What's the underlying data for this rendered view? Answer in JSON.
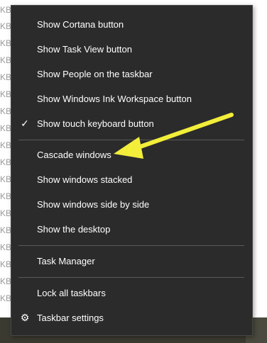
{
  "background": {
    "row_label": "KB",
    "rows": 14
  },
  "menu": {
    "items": [
      {
        "label": "Show Cortana button",
        "checked": false,
        "icon": ""
      },
      {
        "label": "Show Task View button",
        "checked": false,
        "icon": ""
      },
      {
        "label": "Show People on the taskbar",
        "checked": false,
        "icon": ""
      },
      {
        "label": "Show Windows Ink Workspace button",
        "checked": false,
        "icon": ""
      },
      {
        "label": "Show touch keyboard button",
        "checked": true,
        "icon": "checkmark-icon"
      },
      {
        "label": "Cascade windows",
        "checked": false,
        "icon": ""
      },
      {
        "label": "Show windows stacked",
        "checked": false,
        "icon": ""
      },
      {
        "label": "Show windows side by side",
        "checked": false,
        "icon": ""
      },
      {
        "label": "Show the desktop",
        "checked": false,
        "icon": ""
      },
      {
        "label": "Task Manager",
        "checked": false,
        "icon": ""
      },
      {
        "label": "Lock all taskbars",
        "checked": false,
        "icon": ""
      },
      {
        "label": "Taskbar settings",
        "checked": false,
        "icon": "gear-icon"
      }
    ],
    "glyphs": {
      "check": "✓",
      "gear": "⚙"
    }
  },
  "colors": {
    "menu_background": "#2b2b2b",
    "menu_text": "#ffffff",
    "separator": "#5a5a5a",
    "annotation_arrow": "#f2ee3a"
  }
}
